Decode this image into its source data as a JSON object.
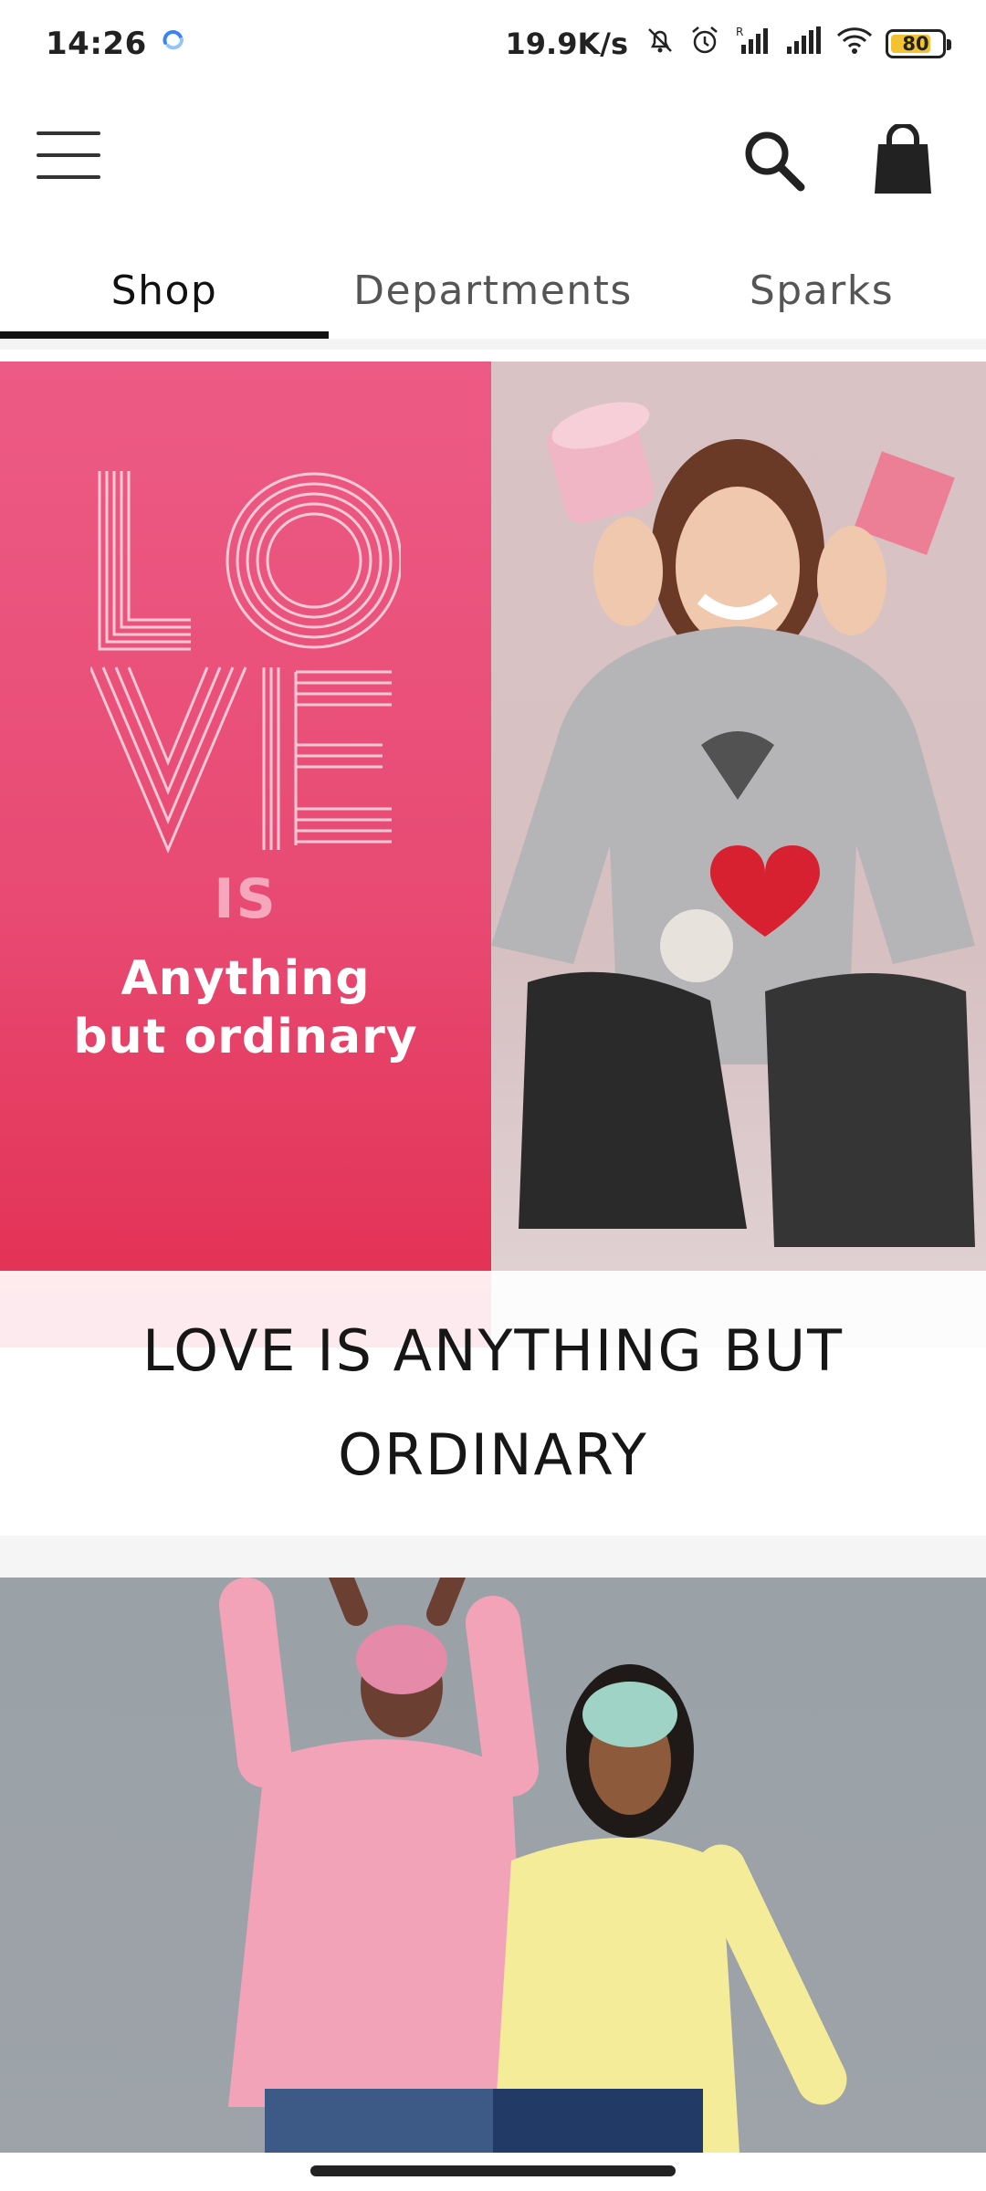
{
  "status_bar": {
    "time": "14:26",
    "network_speed": "19.9K/s",
    "battery_level": "80",
    "battery_percent": 80,
    "icons": [
      "sync-icon",
      "mute-bell-icon",
      "alarm-icon",
      "signal-icon",
      "signal-icon",
      "wifi-icon",
      "battery-icon"
    ]
  },
  "header": {
    "icons": [
      "menu-icon",
      "search-icon",
      "shopping-bag-icon"
    ]
  },
  "tabs": [
    {
      "label": "Shop",
      "active": true
    },
    {
      "label": "Departments",
      "active": false
    },
    {
      "label": "Sparks",
      "active": false
    }
  ],
  "hero": {
    "graphic_word": "LOVE",
    "is_text": "IS",
    "tagline_line1": "Anything",
    "tagline_line2": "but ordinary",
    "caption": "LOVE IS ANYTHING BUT ORDINARY",
    "left_color": "#e84a73",
    "right_color": "#d9c3c5"
  },
  "banner2": {
    "background_color": "#9aa1a7"
  }
}
